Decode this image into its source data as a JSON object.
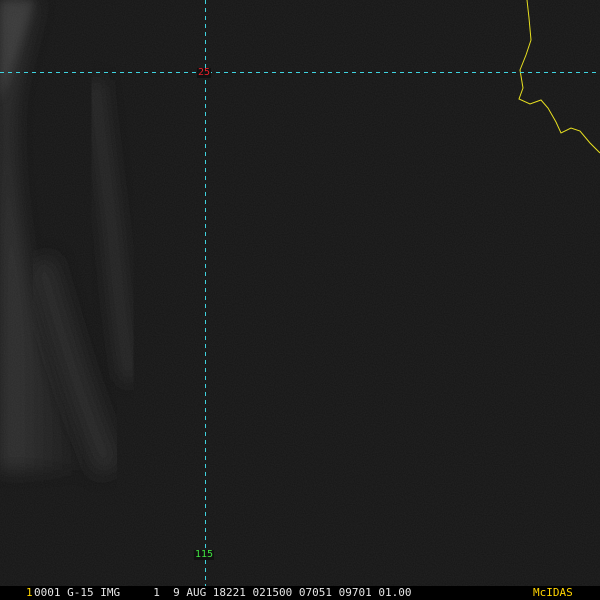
{
  "map": {
    "graticule": {
      "latitude_label": "25",
      "longitude_label": "115",
      "line_color": "#3fd4e0"
    },
    "border_color": "#e8e020",
    "label_colors": {
      "latitude": "#e8202a",
      "longitude": "#3fe03f"
    }
  },
  "status_bar": {
    "frame_number": "1",
    "image_info": "0001 G-15 IMG     1  9 AUG 18221 021500 07051 09701 01.00",
    "brand": "McIDAS"
  }
}
